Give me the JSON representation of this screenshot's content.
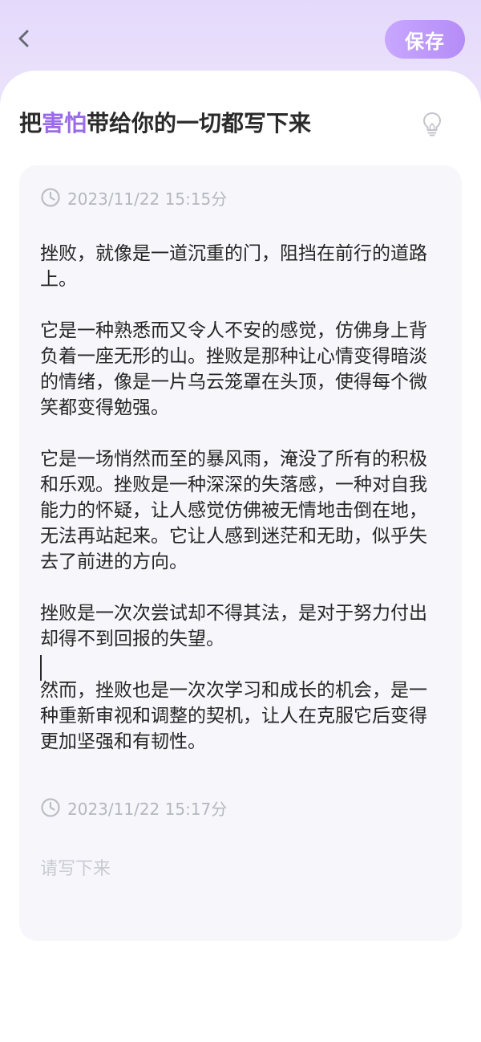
{
  "header": {
    "save_label": "保存"
  },
  "title": {
    "prefix": "把",
    "highlight": "害怕",
    "suffix": "带给你的一切都写下来",
    "highlight_color": "#9a6ae8"
  },
  "entries": [
    {
      "time": "2023/11/22 15:15分",
      "paragraphs": [
        "挫败，就像是一道沉重的门，阻挡在前行的道路上。",
        "它是一种熟悉而又令人不安的感觉，仿佛身上背负着一座无形的山。挫败是那种让心情变得暗淡的情绪，像是一片乌云笼罩在头顶，使得每个微笑都变得勉强。",
        "它是一场悄然而至的暴风雨，淹没了所有的积极和乐观。挫败是一种深深的失落感，一种对自我能力的怀疑，让人感觉仿佛被无情地击倒在地，无法再站起来。它让人感到迷茫和无助，似乎失去了前进的方向。",
        "挫败是一次次尝试却不得其法，是对于努力付出却得不到回报的失望。\n\n然而，挫败也是一次次学习和成长的机会，是一种重新审视和调整的契机，让人在克服它后变得更加坚强和有韧性。"
      ]
    },
    {
      "time": "2023/11/22 15:17分",
      "placeholder": "请写下来"
    }
  ],
  "icons": {
    "back": "chevron-left-icon",
    "clock": "clock-icon",
    "bulb": "lightbulb-icon"
  },
  "colors": {
    "accent": "#b58cf6",
    "header_bg": "#e6dcfa",
    "card_bg": "#f6f6fb"
  }
}
